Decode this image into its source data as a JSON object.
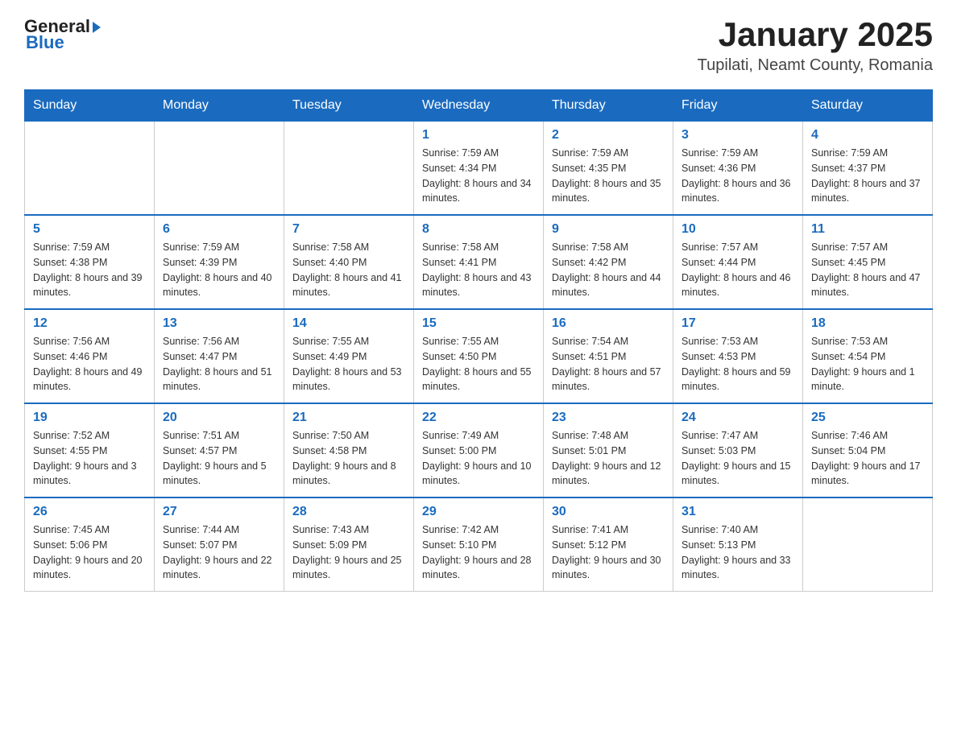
{
  "header": {
    "logo": {
      "text_general": "General",
      "text_blue": "Blue",
      "arrow": true
    },
    "title": "January 2025",
    "location": "Tupilati, Neamt County, Romania"
  },
  "days_of_week": [
    "Sunday",
    "Monday",
    "Tuesday",
    "Wednesday",
    "Thursday",
    "Friday",
    "Saturday"
  ],
  "weeks": [
    [
      null,
      null,
      null,
      {
        "day": "1",
        "sunrise": "7:59 AM",
        "sunset": "4:34 PM",
        "daylight": "8 hours and 34 minutes."
      },
      {
        "day": "2",
        "sunrise": "7:59 AM",
        "sunset": "4:35 PM",
        "daylight": "8 hours and 35 minutes."
      },
      {
        "day": "3",
        "sunrise": "7:59 AM",
        "sunset": "4:36 PM",
        "daylight": "8 hours and 36 minutes."
      },
      {
        "day": "4",
        "sunrise": "7:59 AM",
        "sunset": "4:37 PM",
        "daylight": "8 hours and 37 minutes."
      }
    ],
    [
      {
        "day": "5",
        "sunrise": "7:59 AM",
        "sunset": "4:38 PM",
        "daylight": "8 hours and 39 minutes."
      },
      {
        "day": "6",
        "sunrise": "7:59 AM",
        "sunset": "4:39 PM",
        "daylight": "8 hours and 40 minutes."
      },
      {
        "day": "7",
        "sunrise": "7:58 AM",
        "sunset": "4:40 PM",
        "daylight": "8 hours and 41 minutes."
      },
      {
        "day": "8",
        "sunrise": "7:58 AM",
        "sunset": "4:41 PM",
        "daylight": "8 hours and 43 minutes."
      },
      {
        "day": "9",
        "sunrise": "7:58 AM",
        "sunset": "4:42 PM",
        "daylight": "8 hours and 44 minutes."
      },
      {
        "day": "10",
        "sunrise": "7:57 AM",
        "sunset": "4:44 PM",
        "daylight": "8 hours and 46 minutes."
      },
      {
        "day": "11",
        "sunrise": "7:57 AM",
        "sunset": "4:45 PM",
        "daylight": "8 hours and 47 minutes."
      }
    ],
    [
      {
        "day": "12",
        "sunrise": "7:56 AM",
        "sunset": "4:46 PM",
        "daylight": "8 hours and 49 minutes."
      },
      {
        "day": "13",
        "sunrise": "7:56 AM",
        "sunset": "4:47 PM",
        "daylight": "8 hours and 51 minutes."
      },
      {
        "day": "14",
        "sunrise": "7:55 AM",
        "sunset": "4:49 PM",
        "daylight": "8 hours and 53 minutes."
      },
      {
        "day": "15",
        "sunrise": "7:55 AM",
        "sunset": "4:50 PM",
        "daylight": "8 hours and 55 minutes."
      },
      {
        "day": "16",
        "sunrise": "7:54 AM",
        "sunset": "4:51 PM",
        "daylight": "8 hours and 57 minutes."
      },
      {
        "day": "17",
        "sunrise": "7:53 AM",
        "sunset": "4:53 PM",
        "daylight": "8 hours and 59 minutes."
      },
      {
        "day": "18",
        "sunrise": "7:53 AM",
        "sunset": "4:54 PM",
        "daylight": "9 hours and 1 minute."
      }
    ],
    [
      {
        "day": "19",
        "sunrise": "7:52 AM",
        "sunset": "4:55 PM",
        "daylight": "9 hours and 3 minutes."
      },
      {
        "day": "20",
        "sunrise": "7:51 AM",
        "sunset": "4:57 PM",
        "daylight": "9 hours and 5 minutes."
      },
      {
        "day": "21",
        "sunrise": "7:50 AM",
        "sunset": "4:58 PM",
        "daylight": "9 hours and 8 minutes."
      },
      {
        "day": "22",
        "sunrise": "7:49 AM",
        "sunset": "5:00 PM",
        "daylight": "9 hours and 10 minutes."
      },
      {
        "day": "23",
        "sunrise": "7:48 AM",
        "sunset": "5:01 PM",
        "daylight": "9 hours and 12 minutes."
      },
      {
        "day": "24",
        "sunrise": "7:47 AM",
        "sunset": "5:03 PM",
        "daylight": "9 hours and 15 minutes."
      },
      {
        "day": "25",
        "sunrise": "7:46 AM",
        "sunset": "5:04 PM",
        "daylight": "9 hours and 17 minutes."
      }
    ],
    [
      {
        "day": "26",
        "sunrise": "7:45 AM",
        "sunset": "5:06 PM",
        "daylight": "9 hours and 20 minutes."
      },
      {
        "day": "27",
        "sunrise": "7:44 AM",
        "sunset": "5:07 PM",
        "daylight": "9 hours and 22 minutes."
      },
      {
        "day": "28",
        "sunrise": "7:43 AM",
        "sunset": "5:09 PM",
        "daylight": "9 hours and 25 minutes."
      },
      {
        "day": "29",
        "sunrise": "7:42 AM",
        "sunset": "5:10 PM",
        "daylight": "9 hours and 28 minutes."
      },
      {
        "day": "30",
        "sunrise": "7:41 AM",
        "sunset": "5:12 PM",
        "daylight": "9 hours and 30 minutes."
      },
      {
        "day": "31",
        "sunrise": "7:40 AM",
        "sunset": "5:13 PM",
        "daylight": "9 hours and 33 minutes."
      },
      null
    ]
  ]
}
